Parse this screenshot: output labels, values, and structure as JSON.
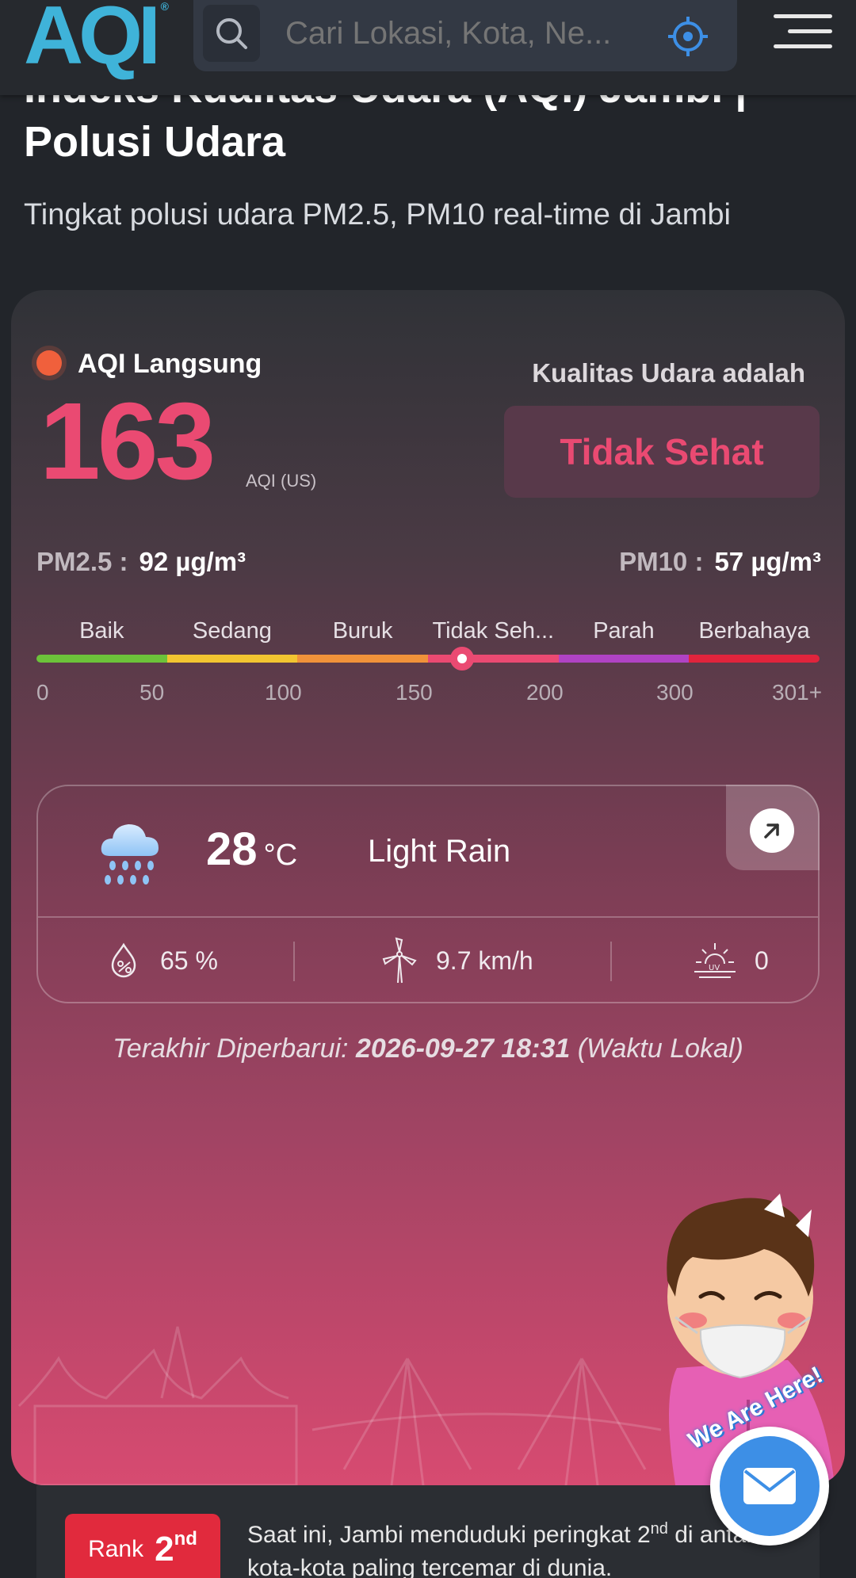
{
  "header": {
    "logo_text": "AQI",
    "logo_mark": "®",
    "search_placeholder": "Cari Lokasi, Kota, Ne...",
    "icons": [
      "search-icon",
      "location-target-icon",
      "hamburger-menu-icon"
    ]
  },
  "page": {
    "title_line1": "Indeks Kualitas Udara (AQI) Jambi |",
    "title_line2": "Polusi Udara",
    "subtitle": "Tingkat polusi udara PM2.5, PM10 real-time di Jambi"
  },
  "aqi": {
    "live_label": "AQI Langsung",
    "value": "163",
    "unit": "AQI (US)",
    "quality_label": "Kualitas Udara adalah",
    "quality_status": "Tidak Sehat",
    "pm25_label": "PM2.5 :",
    "pm25_value": "92 µg/m³",
    "pm10_label": "PM10 :",
    "pm10_value": "57 µg/m³",
    "accent_color": "#ea4a72"
  },
  "scale": {
    "labels": [
      "Baik",
      "Sedang",
      "Buruk",
      "Tidak Seh...",
      "Parah",
      "Berbahaya"
    ],
    "colors": [
      "#6cc33a",
      "#f2c531",
      "#f0923a",
      "#ea4a72",
      "#b043c4",
      "#e0243c"
    ],
    "ticks": [
      "0",
      "50",
      "100",
      "150",
      "200",
      "300",
      "301+"
    ],
    "marker_value": 163
  },
  "weather": {
    "icon": "cloud-rain-icon",
    "temp": "28",
    "temp_unit": "°C",
    "condition": "Light Rain",
    "humidity": "65 %",
    "wind": "9.7 km/h",
    "uv": "0"
  },
  "updated": {
    "label": "Terakhir Diperbarui:",
    "datetime": "2026-09-27 18:31",
    "suffix": "(Waktu Lokal)"
  },
  "chat": {
    "bubble_text": "We Are Here!"
  },
  "rank": {
    "label": "Rank",
    "number": "2",
    "ordinal": "nd",
    "text_before": "Saat ini, Jambi menduduki peringkat 2",
    "text_sup": "nd",
    "text_after": " di antara kota-kota paling tercemar di dunia."
  }
}
